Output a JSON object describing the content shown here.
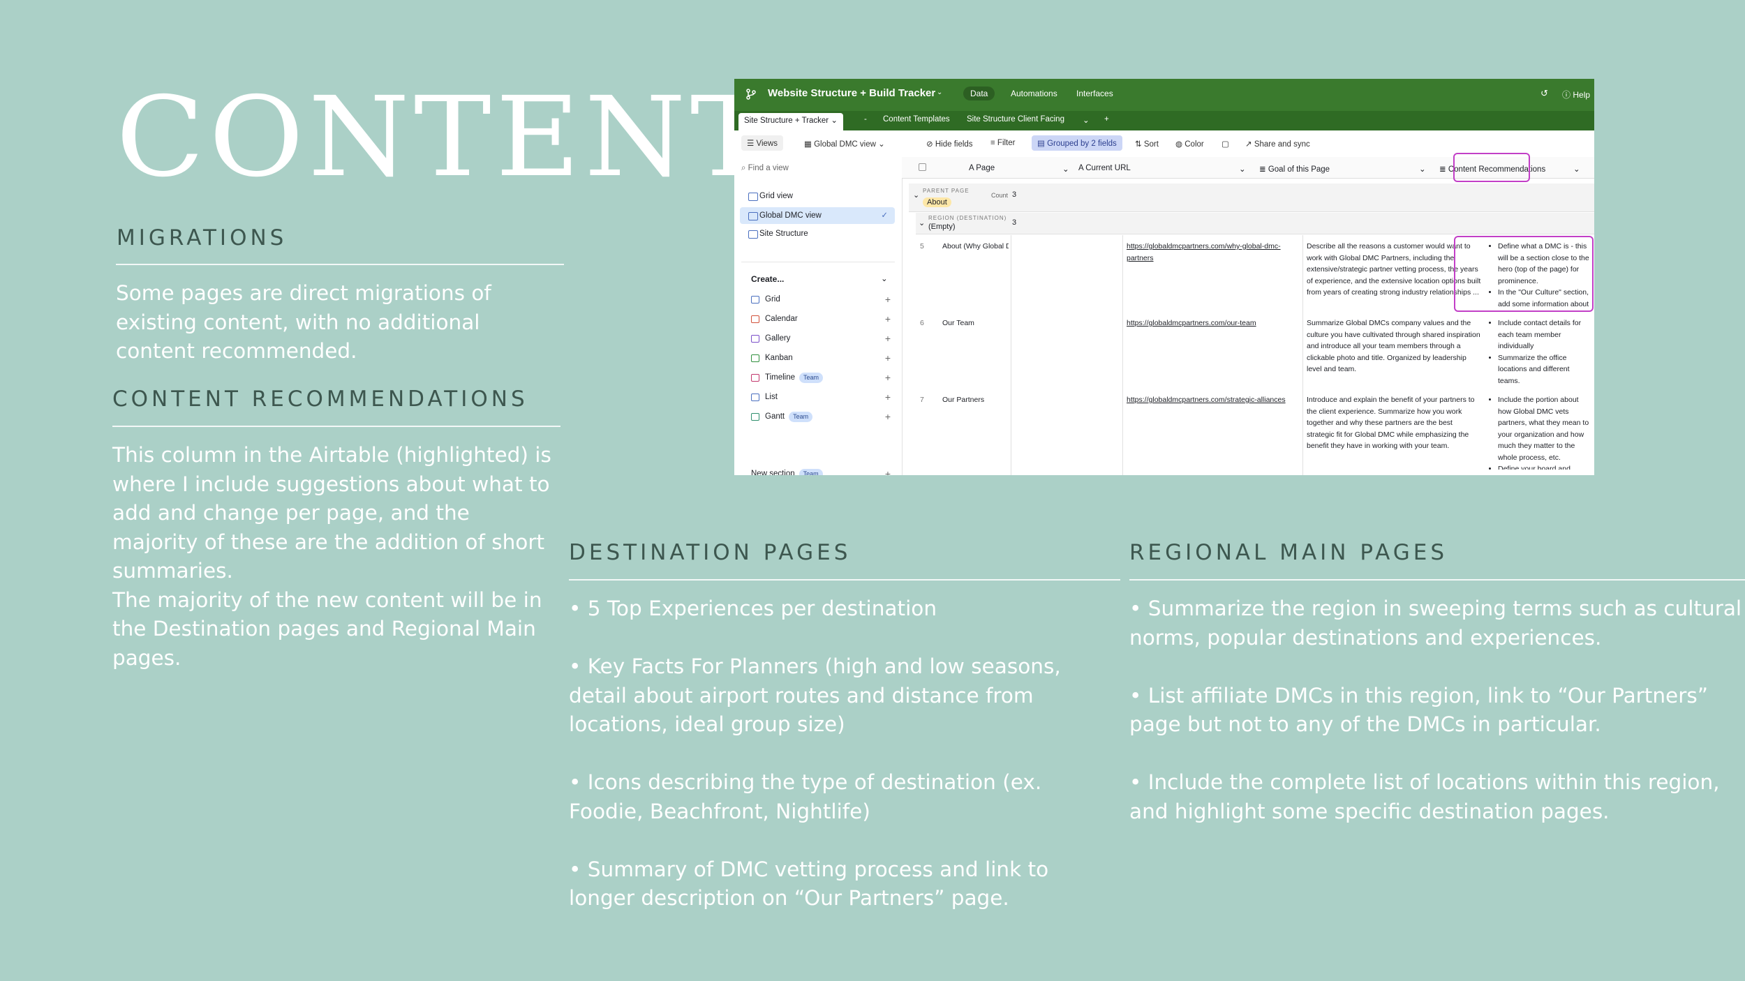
{
  "slide": {
    "title": "CONTENT",
    "migrations": {
      "heading": "MIGRATIONS",
      "text": "Some pages are direct migrations of existing content, with no additional content recommended."
    },
    "recommendations": {
      "heading": "CONTENT RECOMMENDATIONS",
      "paragraphs": [
        "This column in the Airtable (highlighted) is where I include suggestions about what to add and change per page, and the majority of these are the addition of short summaries.",
        "The majority of the new content will be in the Destination pages and Regional Main pages."
      ]
    },
    "destination": {
      "heading": "DESTINATION PAGES",
      "bullets": [
        "• 5 Top Experiences per destination",
        "• Key Facts For Planners (high and low seasons, detail about airport routes and distance from locations, ideal group size)",
        "• Icons describing the type of destination (ex. Foodie, Beachfront, Nightlife)",
        "• Summary of DMC vetting process and link to longer description on “Our Partners” page."
      ]
    },
    "regional": {
      "heading": "REGIONAL MAIN PAGES",
      "bullets": [
        "• Summarize the region in sweeping terms such as cultural norms, popular destinations and experiences.",
        "• List affiliate DMCs in this region, link to “Our Partners” page but not to any of the DMCs in particular.",
        "• Include the complete list of locations within this region, and highlight some specific destination pages."
      ]
    }
  },
  "airtable": {
    "base_title": "Website Structure + Build Tracker",
    "top_nav": [
      "Data",
      "Automations",
      "Interfaces"
    ],
    "help": "Help",
    "tabs": {
      "active": "Site Structure + Tracker",
      "dash": "-",
      "templates": "Content Templates",
      "client": "Site Structure Client Facing",
      "add": "+"
    },
    "toolbar": {
      "views": "Views",
      "current_view": "Global DMC view",
      "hide_fields": "Hide fields",
      "filter": "Filter",
      "grouped": "Grouped by 2 fields",
      "sort": "Sort",
      "color": "Color",
      "share": "Share and sync"
    },
    "sidebar": {
      "find_placeholder": "Find a view",
      "views": [
        "Grid view",
        "Global DMC view",
        "Site Structure"
      ],
      "create_label": "Create...",
      "create_items": [
        {
          "label": "Grid",
          "team": ""
        },
        {
          "label": "Calendar",
          "team": ""
        },
        {
          "label": "Gallery",
          "team": ""
        },
        {
          "label": "Kanban",
          "team": ""
        },
        {
          "label": "Timeline",
          "team": "Team"
        },
        {
          "label": "List",
          "team": ""
        },
        {
          "label": "Gantt",
          "team": "Team"
        },
        {
          "label": "New section",
          "team": "Team"
        }
      ]
    },
    "columns": [
      "Page",
      "Current URL",
      "Goal of this Page",
      "Content Recommendations"
    ],
    "group1": {
      "label": "PARENT PAGE",
      "value": "About",
      "count_label": "Count",
      "count": "3"
    },
    "group2": {
      "label": "REGION (DESTINATION)",
      "value": "(Empty)",
      "count": "3"
    },
    "rows": [
      {
        "num": "5",
        "page": "About (Why Global DMC)",
        "url": "https://globaldmcpartners.com/why-global-dmc-partners",
        "goal": "Describe all the reasons a customer would want to work with Global DMC Partners, including the extensive/strategic partner vetting process, the years of experience, and the extensive location options built from years of creating strong industry relationships ...",
        "recs": [
          "Define what a DMC is - this will be a section close to the hero (top of the page) for prominence.",
          "In the \"Our Culture\" section, add some information about the longevity of your core team, how ..."
        ]
      },
      {
        "num": "6",
        "page": "Our Team",
        "url": "https://globaldmcpartners.com/our-team",
        "goal": "Summarize Global DMCs company values and the culture you have cultivated through shared inspiration and introduce all your team members through a clickable photo and title. Organized by leadership level and team.",
        "recs": [
          "Include contact details for each team member individually",
          "Summarize the office locations and different teams."
        ]
      },
      {
        "num": "7",
        "page": "Our Partners",
        "url": "https://globaldmcpartners.com/strategic-alliances",
        "goal": "Introduce and explain the benefit of your partners to the client experience. Summarize how you work together and why these partners are the best strategic fit for Global DMC while emphasizing the benefit they have in working with your team.",
        "recs": [
          "Include the portion about how Global DMC vets partners, what they mean to your organization and how much they matter to the whole process, etc.",
          "Define your board and thank them..."
        ]
      }
    ],
    "colors": {
      "topbar": "#3a7a2d",
      "highlight": "#c23fc7",
      "selected_view": "#d9e8fb"
    }
  }
}
